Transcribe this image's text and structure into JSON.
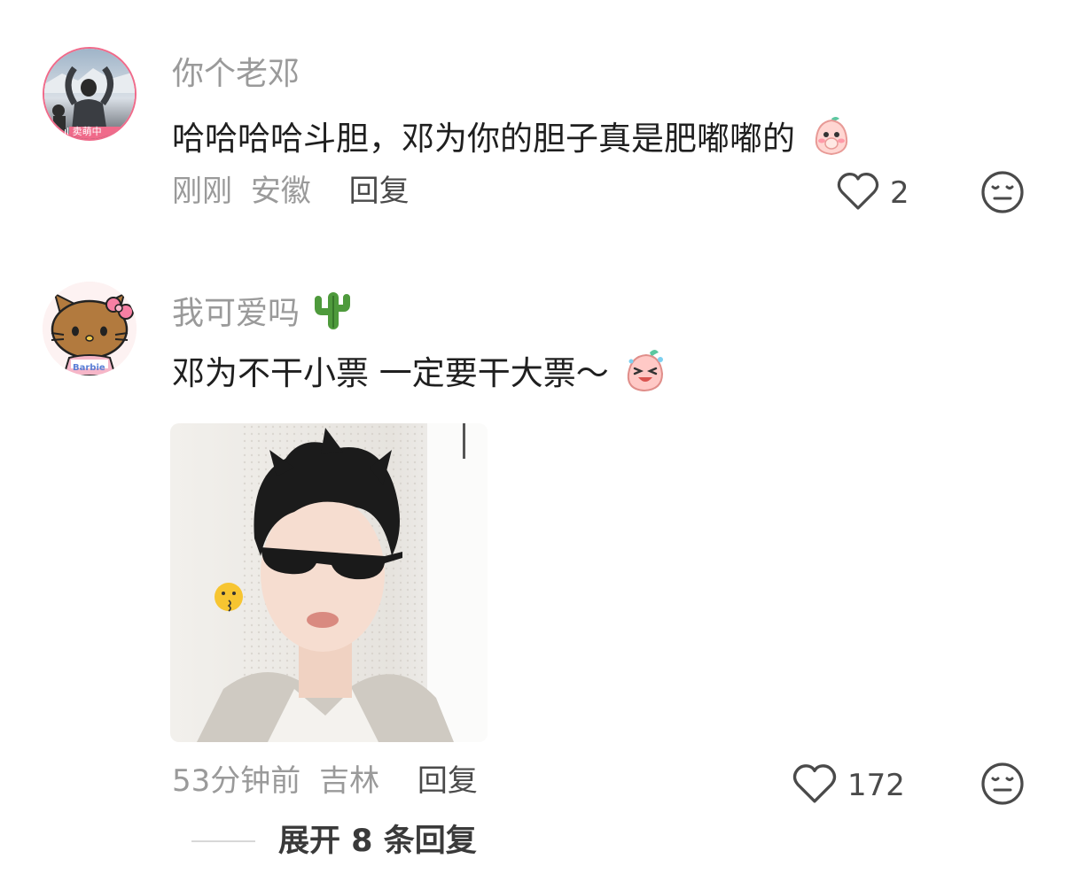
{
  "comments": [
    {
      "username": "你个老邓",
      "avatar_badge": "ıl 卖萌中",
      "text": "哈哈哈哈斗胆，邓为你的胆子真是肥嘟嘟的",
      "text_emoji": "peach-bun-shy-sticker",
      "time": "刚刚",
      "location": "安徽",
      "reply_label": "回复",
      "like_count": "2",
      "like_icon": "heart-outline-icon",
      "dislike_icon": "expressionless-face-icon"
    },
    {
      "username": "我可爱吗",
      "username_emoji": "cactus",
      "avatar_badge": "Barbie",
      "text": "邓为不干小票 一定要干大票～",
      "text_emoji": "peach-bun-laughing-sticker",
      "image_description_icon": "photo-attachment",
      "time": "53分钟前",
      "location": "吉林",
      "reply_label": "回复",
      "like_count": "172",
      "like_icon": "heart-outline-icon",
      "dislike_icon": "expressionless-face-icon"
    }
  ],
  "expand_replies_label": "展开 8 条回复",
  "colors": {
    "username": "#9a9a9a",
    "content": "#1f1f1f",
    "meta": "#9a9a9a",
    "action": "#4a4a4a",
    "avatar_ring": "#f06a8a"
  }
}
